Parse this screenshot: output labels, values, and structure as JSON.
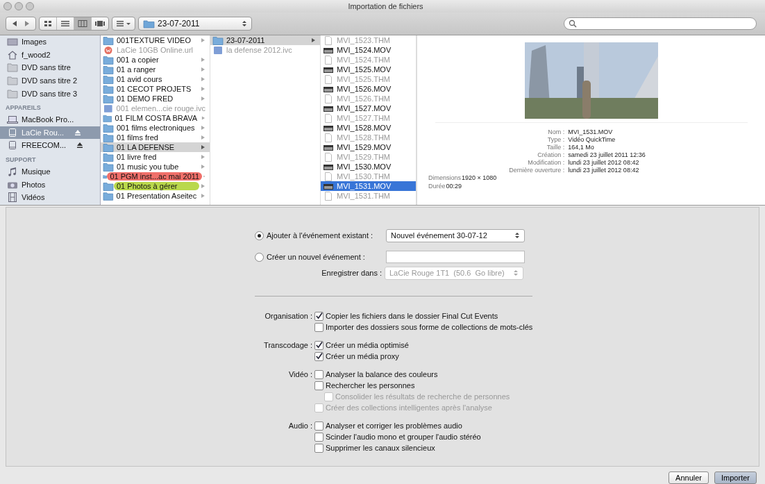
{
  "window": {
    "title": "Importation de fichiers"
  },
  "toolbar": {
    "views": [
      {
        "kind": "icons",
        "selected": false
      },
      {
        "kind": "list",
        "selected": false
      },
      {
        "kind": "columns",
        "selected": true
      },
      {
        "kind": "coverflow",
        "selected": false
      }
    ],
    "path": "23-07-2011"
  },
  "sidebar": [
    {
      "items": [
        {
          "label": "Images",
          "kind": "pictures",
          "selected": false,
          "eject": false
        },
        {
          "label": "f_wood2",
          "kind": "home",
          "selected": false,
          "eject": false
        },
        {
          "label": "DVD sans titre",
          "kind": "folder",
          "selected": false,
          "eject": false
        },
        {
          "label": "DVD sans titre 2",
          "kind": "folder",
          "selected": false,
          "eject": false
        },
        {
          "label": "DVD sans titre 3",
          "kind": "folder",
          "selected": false,
          "eject": false
        }
      ]
    },
    {
      "heading": "APPAREILS",
      "items": [
        {
          "label": "MacBook Pro...",
          "kind": "laptop",
          "selected": false,
          "eject": false
        },
        {
          "label": "LaCie Rou...",
          "kind": "drive",
          "selected": true,
          "eject": true
        },
        {
          "label": "FREECOM...",
          "kind": "drive",
          "selected": false,
          "eject": true
        }
      ]
    },
    {
      "heading": "SUPPORT",
      "items": [
        {
          "label": "Musique",
          "kind": "music",
          "selected": false,
          "eject": false
        },
        {
          "label": "Photos",
          "kind": "camera",
          "selected": false,
          "eject": false
        },
        {
          "label": "Vidéos",
          "kind": "film",
          "selected": false,
          "eject": false
        }
      ]
    }
  ],
  "columns": [
    {
      "focused": false,
      "items": [
        {
          "label": "001TEXTURE VIDEO",
          "kind": "folder",
          "selected": false,
          "disabled": false
        },
        {
          "label": "LaCie 10GB Online.url",
          "kind": "link",
          "selected": false,
          "disabled": true
        },
        {
          "label": "001 a copier",
          "kind": "folder",
          "selected": false,
          "disabled": false
        },
        {
          "label": "01 a ranger",
          "kind": "folder",
          "selected": false,
          "disabled": false
        },
        {
          "label": "01 avid cours",
          "kind": "folder",
          "selected": false,
          "disabled": false
        },
        {
          "label": "01 CECOT PROJETS",
          "kind": "folder",
          "selected": false,
          "disabled": false
        },
        {
          "label": "01 DEMO FRED",
          "kind": "folder",
          "selected": false,
          "disabled": false
        },
        {
          "label": "001 elemen...cie rouge.ivc",
          "kind": "library",
          "selected": false,
          "disabled": true
        },
        {
          "label": "01 FILM COSTA BRAVA",
          "kind": "folder",
          "selected": false,
          "disabled": false
        },
        {
          "label": "001 films electroniques",
          "kind": "folder",
          "selected": false,
          "disabled": false
        },
        {
          "label": "01 films fred",
          "kind": "folder",
          "selected": false,
          "disabled": false
        },
        {
          "label": "01 LA DEFENSE",
          "kind": "folder",
          "selected": true,
          "disabled": false
        },
        {
          "label": "01 livre fred",
          "kind": "folder",
          "selected": false,
          "disabled": false
        },
        {
          "label": "01 music you tube",
          "kind": "folder",
          "selected": false,
          "disabled": false
        },
        {
          "label": "01 PGM inst...ac mai 2011",
          "kind": "folder",
          "selected": false,
          "disabled": false,
          "color": "#f0706a"
        },
        {
          "label": "01 Photos à gérer",
          "kind": "folder",
          "selected": false,
          "disabled": false,
          "color": "#b9d84c"
        },
        {
          "label": "01 Presentation Aseitec",
          "kind": "folder",
          "selected": false,
          "disabled": false
        }
      ]
    },
    {
      "focused": false,
      "items": [
        {
          "label": "23-07-2011",
          "kind": "folder",
          "selected": true,
          "disabled": false
        },
        {
          "label": "la defense 2012.ivc",
          "kind": "library",
          "selected": false,
          "disabled": true
        }
      ]
    },
    {
      "focused": true,
      "items": [
        {
          "label": "MVI_1523.THM",
          "kind": "thm",
          "selected": false,
          "disabled": true
        },
        {
          "label": "MVI_1524.MOV",
          "kind": "movie",
          "selected": false,
          "disabled": false
        },
        {
          "label": "MVI_1524.THM",
          "kind": "thm",
          "selected": false,
          "disabled": true
        },
        {
          "label": "MVI_1525.MOV",
          "kind": "movie",
          "selected": false,
          "disabled": false
        },
        {
          "label": "MVI_1525.THM",
          "kind": "thm",
          "selected": false,
          "disabled": true
        },
        {
          "label": "MVI_1526.MOV",
          "kind": "movie",
          "selected": false,
          "disabled": false
        },
        {
          "label": "MVI_1526.THM",
          "kind": "thm",
          "selected": false,
          "disabled": true
        },
        {
          "label": "MVI_1527.MOV",
          "kind": "movie",
          "selected": false,
          "disabled": false
        },
        {
          "label": "MVI_1527.THM",
          "kind": "thm",
          "selected": false,
          "disabled": true
        },
        {
          "label": "MVI_1528.MOV",
          "kind": "movie",
          "selected": false,
          "disabled": false
        },
        {
          "label": "MVI_1528.THM",
          "kind": "thm",
          "selected": false,
          "disabled": true
        },
        {
          "label": "MVI_1529.MOV",
          "kind": "movie",
          "selected": false,
          "disabled": false
        },
        {
          "label": "MVI_1529.THM",
          "kind": "thm",
          "selected": false,
          "disabled": true
        },
        {
          "label": "MVI_1530.MOV",
          "kind": "movie",
          "selected": false,
          "disabled": false
        },
        {
          "label": "MVI_1530.THM",
          "kind": "thm",
          "selected": false,
          "disabled": true
        },
        {
          "label": "MVI_1531.MOV",
          "kind": "movie",
          "selected": true,
          "disabled": false
        },
        {
          "label": "MVI_1531.THM",
          "kind": "thm",
          "selected": false,
          "disabled": true
        }
      ]
    }
  ],
  "preview": {
    "details": [
      {
        "label": "Nom :",
        "value": "MVI_1531.MOV"
      },
      {
        "label": "Type :",
        "value": "Vidéo QuickTime"
      },
      {
        "label": "Taille :",
        "value": "164,1 Mo"
      },
      {
        "label": "Création :",
        "value": "samedi 23 juillet 2011 12:36"
      },
      {
        "label": "Modification :",
        "value": "lundi 23 juillet 2012 08:42"
      },
      {
        "label": "Dernière ouverture :",
        "value": "lundi 23 juillet 2012 08:42"
      }
    ],
    "extra": [
      {
        "label": "Dimensions",
        "value": "1920 × 1080"
      },
      {
        "label": "Durée",
        "value": "00:29"
      }
    ]
  },
  "event": {
    "add_existing": {
      "label": "Ajouter à l'événement existant :",
      "selected": true,
      "value": "Nouvel événement 30-07-12"
    },
    "create_new": {
      "label": "Créer un nouvel événement :",
      "selected": false
    },
    "save_in": {
      "label": "Enregistrer dans :",
      "value": "LaCie Rouge 1T1  (50.6  Go libre)",
      "disabled": true
    }
  },
  "options": [
    {
      "label": "Organisation :",
      "items": [
        {
          "label": "Copier les fichiers dans le dossier Final Cut Events",
          "checked": true,
          "disabled": false
        },
        {
          "label": "Importer des dossiers sous forme de collections de mots-clés",
          "checked": false,
          "disabled": false
        }
      ]
    },
    {
      "label": "Transcodage :",
      "items": [
        {
          "label": "Créer un média optimisé",
          "checked": true,
          "disabled": false
        },
        {
          "label": "Créer un média proxy",
          "checked": true,
          "disabled": false
        }
      ]
    },
    {
      "label": "Vidéo :",
      "items": [
        {
          "label": "Analyser la balance des couleurs",
          "checked": false,
          "disabled": false
        },
        {
          "label": "Rechercher les personnes",
          "checked": false,
          "disabled": false,
          "children": [
            {
              "label": "Consolider les résultats de recherche de personnes",
              "checked": false,
              "disabled": true
            }
          ]
        },
        {
          "label": "Créer des collections intelligentes après l'analyse",
          "checked": false,
          "disabled": true
        }
      ]
    },
    {
      "label": "Audio :",
      "items": [
        {
          "label": "Analyser et corriger les problèmes audio",
          "checked": false,
          "disabled": false
        },
        {
          "label": "Scinder l'audio mono et grouper l'audio stéréo",
          "checked": false,
          "disabled": false
        },
        {
          "label": "Supprimer les canaux silencieux",
          "checked": false,
          "disabled": false
        }
      ]
    }
  ],
  "buttons": [
    {
      "label": "Annuler",
      "default": false
    },
    {
      "label": "Importer",
      "default": true
    }
  ]
}
